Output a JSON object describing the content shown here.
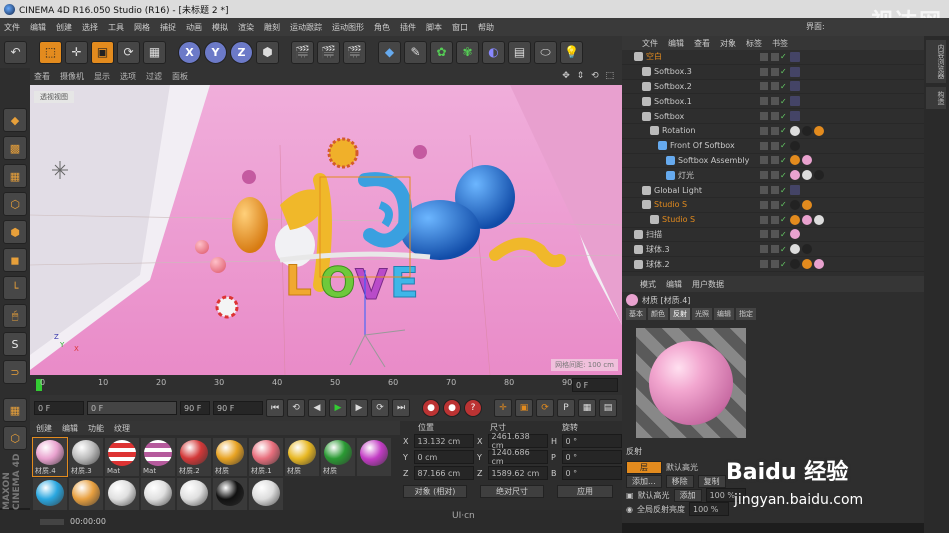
{
  "window": {
    "title": "CINEMA 4D R16.050 Studio (R16) - [未标题 2 *]"
  },
  "watermark": "视达网",
  "baidu": {
    "logo": "Baidu 经验",
    "url": "jingyan.baidu.com"
  },
  "uicn": "UI·cn",
  "menu": [
    "文件",
    "编辑",
    "创建",
    "选择",
    "工具",
    "网格",
    "捕捉",
    "动画",
    "模拟",
    "渲染",
    "雕刻",
    "运动跟踪",
    "运动图形",
    "角色",
    "插件",
    "脚本",
    "窗口",
    "帮助"
  ],
  "layout_label": "界面:",
  "toolbar": {
    "axes": [
      "X",
      "Y",
      "Z"
    ]
  },
  "viewport": {
    "menu": [
      "查看",
      "摄像机",
      "显示",
      "选项",
      "过滤",
      "面板"
    ],
    "label": "透视视图",
    "grid": "网格间距: 100 cm"
  },
  "timeline": {
    "ticks": [
      "0",
      "10",
      "20",
      "30",
      "40",
      "50",
      "60",
      "70",
      "80",
      "90"
    ],
    "end": "0 F"
  },
  "transport": {
    "start": "0 F",
    "cur": "0 F",
    "end": "90 F",
    "max": "90 F"
  },
  "materials": {
    "menu": [
      "创建",
      "编辑",
      "功能",
      "纹理"
    ],
    "items": [
      {
        "label": "材质.4",
        "color": "#e9a2cf",
        "selected": true
      },
      {
        "label": "材质.3",
        "color": "#bcbcbc"
      },
      {
        "label": "Mat",
        "color": "#d33",
        "stripe": true
      },
      {
        "label": "Mat",
        "color": "#b55a9c",
        "stripe": true
      },
      {
        "label": "材质.2",
        "color": "#d33838"
      },
      {
        "label": "材质",
        "color": "#e8a323"
      },
      {
        "label": "材质.1",
        "color": "#e86f7d"
      },
      {
        "label": "材质",
        "color": "#e8b823"
      },
      {
        "label": "材质",
        "color": "#2a9a33"
      },
      {
        "label": "",
        "color": "#c23cc4"
      },
      {
        "label": "",
        "color": "#2aa7e0"
      },
      {
        "label": "",
        "color": "#e8a040"
      },
      {
        "label": "",
        "color": "#e0e0e0"
      },
      {
        "label": "",
        "color": "#e0e0e0"
      },
      {
        "label": "",
        "color": "#e0e0e0"
      },
      {
        "label": "",
        "color": "#111"
      },
      {
        "label": "",
        "color": "#ddd"
      }
    ]
  },
  "coords": {
    "headers": [
      "位置",
      "尺寸",
      "旋转"
    ],
    "rows": [
      {
        "axis": "X",
        "pos": "13.132 cm",
        "size": "2461.638 cm",
        "rotlbl": "H",
        "rot": "0 °"
      },
      {
        "axis": "Y",
        "pos": "0 cm",
        "size": "1240.686 cm",
        "rotlbl": "P",
        "rot": "0 °"
      },
      {
        "axis": "Z",
        "pos": "87.166 cm",
        "size": "1589.62 cm",
        "rotlbl": "B",
        "rot": "0 °"
      }
    ],
    "mode": "对象 (相对)",
    "sizemode": "绝对尺寸",
    "apply": "应用"
  },
  "status": "00:00:00",
  "objects": {
    "menu": [
      "文件",
      "编辑",
      "查看",
      "对象",
      "标签",
      "书签"
    ],
    "rows": [
      {
        "name": "空白",
        "indent": 0,
        "orange": true
      },
      {
        "name": "Softbox.3",
        "indent": 1
      },
      {
        "name": "Softbox.2",
        "indent": 1
      },
      {
        "name": "Softbox.1",
        "indent": 1
      },
      {
        "name": "Softbox",
        "indent": 1
      },
      {
        "name": "Rotation",
        "indent": 2
      },
      {
        "name": "Front Of Softbox",
        "indent": 3
      },
      {
        "name": "Softbox Assembly",
        "indent": 4
      },
      {
        "name": "灯光",
        "indent": 4
      },
      {
        "name": "Global Light",
        "indent": 1
      },
      {
        "name": "Studio S",
        "indent": 1,
        "orange": true
      },
      {
        "name": "Studio S",
        "indent": 2,
        "orange": true
      },
      {
        "name": "扫描",
        "indent": 0
      },
      {
        "name": "球体.3",
        "indent": 0
      },
      {
        "name": "球体.2",
        "indent": 0
      }
    ]
  },
  "attributes": {
    "menu": [
      "模式",
      "编辑",
      "用户数据"
    ],
    "material": "材质 [材质.4]",
    "tabs": [
      "基本",
      "颜色",
      "反射",
      "光照",
      "编辑",
      "指定"
    ],
    "active_tab": "反射",
    "section": "反射",
    "layer_btn": "层",
    "default_spec": "默认高光",
    "add": "添加...",
    "remove": "移除",
    "copy": "复制",
    "default_spec2": "默认高光",
    "add2": "添加",
    "pct": "100 %",
    "global": "全局反射亮度",
    "global_val": "100 %"
  },
  "rightstrip": [
    "内容浏览器",
    "构造"
  ]
}
